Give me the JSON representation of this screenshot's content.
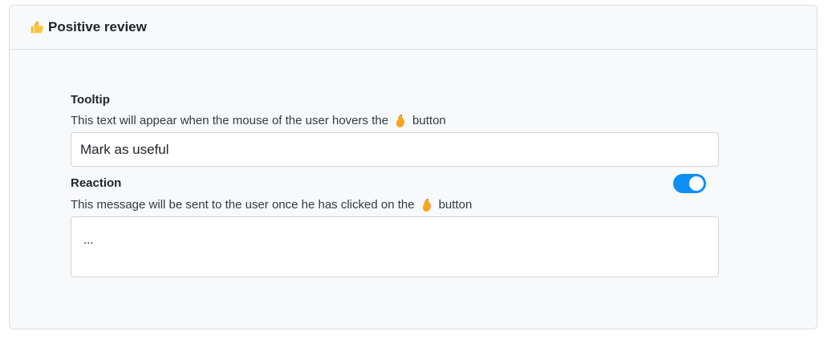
{
  "header": {
    "icon": "thumbs-up-icon",
    "title": "Positive review"
  },
  "tooltip": {
    "label": "Tooltip",
    "help_before": "This text will appear when the mouse of the user hovers the",
    "help_icon": "thumbs-up-icon",
    "help_after": "button",
    "value": "Mark as useful"
  },
  "reaction": {
    "label": "Reaction",
    "toggle_on": true,
    "help_before": "This message will be sent to the user once he has clicked on the",
    "help_icon": "thumbs-up-icon",
    "help_after": "button",
    "value": "..."
  },
  "colors": {
    "accent": "#0d8ef5",
    "card_bg": "#f8f9fa",
    "border": "#dcdfe3"
  }
}
